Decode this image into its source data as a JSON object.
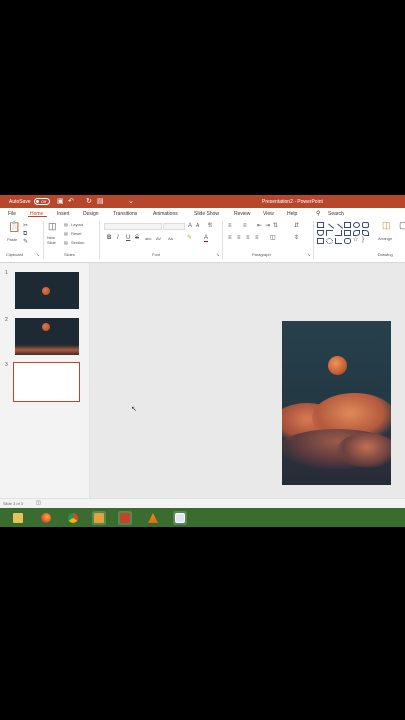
{
  "app": {
    "title": "Presentation2  -  PowerPoint",
    "autosave_label": "AutoSave",
    "autosave_state": "Off",
    "quick_access": [
      "save-icon",
      "undo-icon",
      "redo-icon",
      "present-icon",
      "customize-icon"
    ]
  },
  "tabs": [
    "File",
    "Home",
    "Insert",
    "Design",
    "Transitions",
    "Animations",
    "Slide Show",
    "Review",
    "View",
    "Help"
  ],
  "active_tab": "Home",
  "search": {
    "label": "Search"
  },
  "ribbon": {
    "clipboard": {
      "label": "Clipboard",
      "paste": "Paste"
    },
    "slides": {
      "label": "Slides",
      "new_slide": "New\nSlide",
      "layout": "Layout",
      "reset": "Reset",
      "section": "Section"
    },
    "font": {
      "label": "Font",
      "bold": "B",
      "italic": "I",
      "underline": "U",
      "strike": "S",
      "shadow": "abc",
      "spacing": "AV",
      "case": "Aa"
    },
    "paragraph": {
      "label": "Paragraph"
    },
    "drawing": {
      "label": "Drawing",
      "arrange": "Arrange"
    }
  },
  "slides": [
    {
      "number": "1",
      "kind": "moon"
    },
    {
      "number": "2",
      "kind": "moon-clouds"
    },
    {
      "number": "3",
      "kind": "blank",
      "selected": true
    }
  ],
  "status": {
    "slide_counter": "Slide 3 of 3"
  },
  "taskbar": [
    "file-explorer-icon",
    "firefox-icon",
    "chrome-icon",
    "photos-icon",
    "powerpoint-icon",
    "vlc-icon",
    "screen-recorder-icon"
  ],
  "colors": {
    "accent": "#b7472a",
    "taskbar": "#3a6b2f"
  }
}
